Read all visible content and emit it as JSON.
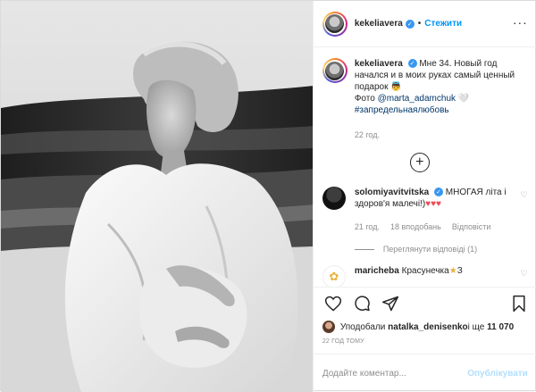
{
  "header": {
    "username": "kekeliavera",
    "separator": "•",
    "follow_label": "Стежити",
    "more_icon": "more-options-icon"
  },
  "caption": {
    "username": "kekeliavera",
    "text": "Мне 34. Новый год начался и в моих руках самый ценный подарок 👼",
    "photo_prefix": "Фото ",
    "photo_credit": "@marta_adamchuk",
    "credit_suffix": " 🤍",
    "hashtag": "#запредельнаялюбовь",
    "time": "22 год."
  },
  "comments": [
    {
      "username": "solomiyavitvitska",
      "text": "МНОГАЯ літа і здоров'я малечі!)",
      "hearts": "♥♥♥",
      "time": "21 год.",
      "likes": "18 вподобань",
      "reply": "Відповісти",
      "view_replies": "Переглянути відповіді (1)"
    },
    {
      "username": "maricheba",
      "text": "Красунечка",
      "star": "★",
      "extra": "З"
    }
  ],
  "likes_line": {
    "prefix": "Уподобали ",
    "user": "natalka_denisenko",
    "middle": " і ще ",
    "count": "11 070"
  },
  "post_date": "22 ГОД ТОМУ",
  "add_comment": {
    "placeholder": "Додайте коментар...",
    "publish_label": "Опублікувати"
  },
  "colors": {
    "link_blue": "#0095f6",
    "verified_blue": "#3897f0",
    "heart_red": "#ed4956",
    "muted": "#8e8e8e"
  }
}
